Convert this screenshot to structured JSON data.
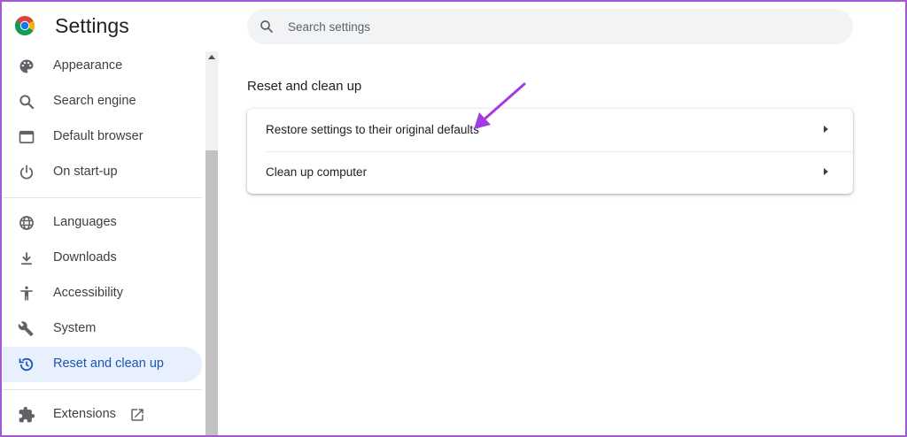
{
  "app": {
    "title": "Settings"
  },
  "search": {
    "placeholder": "Search settings"
  },
  "sidebar": {
    "items": [
      {
        "label": "Appearance",
        "icon": "palette-icon"
      },
      {
        "label": "Search engine",
        "icon": "search-icon"
      },
      {
        "label": "Default browser",
        "icon": "browser-window-icon"
      },
      {
        "label": "On start-up",
        "icon": "power-icon"
      },
      {
        "label": "Languages",
        "icon": "globe-icon"
      },
      {
        "label": "Downloads",
        "icon": "download-icon"
      },
      {
        "label": "Accessibility",
        "icon": "accessibility-icon"
      },
      {
        "label": "System",
        "icon": "wrench-icon"
      },
      {
        "label": "Reset and clean up",
        "icon": "history-reset-icon",
        "active": true
      },
      {
        "label": "Extensions",
        "icon": "puzzle-icon",
        "external_icon": "open-in-new-icon"
      }
    ]
  },
  "main": {
    "section_title": "Reset and clean up",
    "rows": [
      {
        "label": "Restore settings to their original defaults"
      },
      {
        "label": "Clean up computer"
      }
    ]
  },
  "colors": {
    "accent": "#1a56b8",
    "active_bg": "#e8f0fe",
    "annotation_arrow": "#a33ce0",
    "frame": "#a05ad8"
  }
}
